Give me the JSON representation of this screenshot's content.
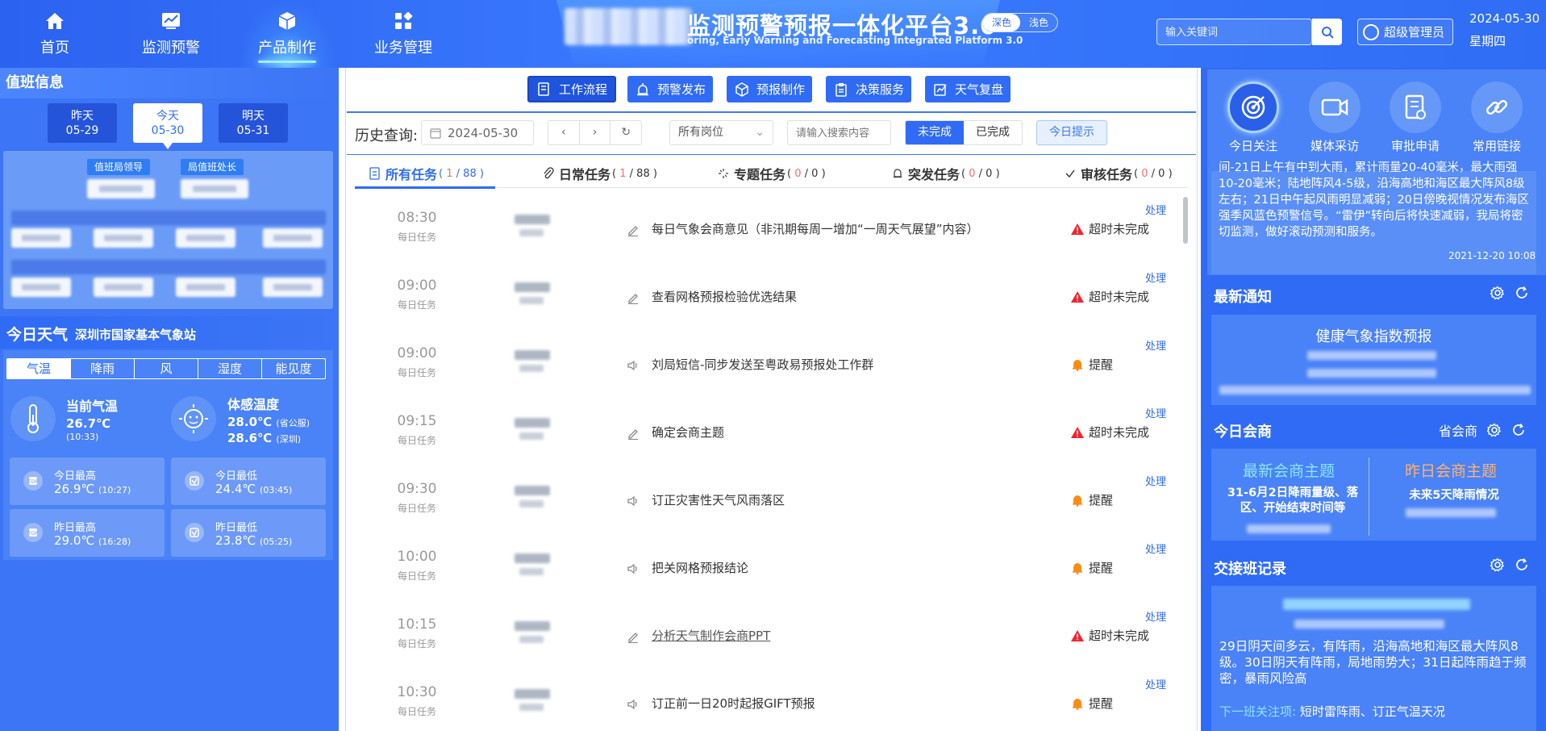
{
  "colors": {
    "primary": "#2f6bf5",
    "danger": "#f5222d",
    "warning": "#fa8c16",
    "accent_cyan": "#8ce6ff",
    "accent_orange": "#ffb36b"
  },
  "nav": [
    {
      "label": "首页",
      "icon": "home-icon"
    },
    {
      "label": "监测预警",
      "icon": "chart-icon"
    },
    {
      "label": "产品制作",
      "icon": "cube-icon",
      "active": true
    },
    {
      "label": "业务管理",
      "icon": "grid-icon"
    }
  ],
  "header": {
    "title": "监测预警预报一体化平台3.0",
    "subtitle": "oring, Early Warning and Forecasting Integrated Platform 3.0",
    "theme_dark": "深色",
    "theme_light": "浅色",
    "search_placeholder": "输入关键词",
    "user": "超级管理员",
    "date": "2024-05-30",
    "weekday": "星期四"
  },
  "duty": {
    "title": "值班信息",
    "days": [
      {
        "name": "昨天",
        "date": "05-29"
      },
      {
        "name": "今天",
        "date": "05-30",
        "selected": true
      },
      {
        "name": "明天",
        "date": "05-31"
      }
    ],
    "tags": [
      "值班局领导",
      "局值班处长"
    ]
  },
  "weather": {
    "title": "今日天气",
    "station": "深圳市国家基本气象站",
    "tabs": [
      "气温",
      "降雨",
      "风",
      "湿度",
      "能见度"
    ],
    "active_tab": "气温",
    "current_label": "当前气温",
    "current_value": "26.7℃",
    "current_time": "(10:33)",
    "feel_label": "体感温度",
    "feel_value1": "28.0℃",
    "feel_note1": "(省公服)",
    "feel_value2": "28.6℃",
    "feel_note2": "(深圳)",
    "cards": [
      {
        "label": "今日最高",
        "value": "26.9℃",
        "time": "(10:27)",
        "icon": "high-temp-icon"
      },
      {
        "label": "今日最低",
        "value": "24.4℃",
        "time": "(03:45)",
        "icon": "low-temp-icon"
      },
      {
        "label": "昨日最高",
        "value": "29.0℃",
        "time": "(16:28)",
        "icon": "high-temp-icon"
      },
      {
        "label": "昨日最低",
        "value": "23.8℃",
        "time": "(05:25)",
        "icon": "low-temp-icon"
      }
    ]
  },
  "workflow": [
    {
      "label": "工作流程",
      "active": true
    },
    {
      "label": "预警发布"
    },
    {
      "label": "预报制作"
    },
    {
      "label": "决策服务"
    },
    {
      "label": "天气复盘"
    }
  ],
  "filters": {
    "history_label": "历史查询:",
    "date": "2024-05-30",
    "post_select": "所有岗位",
    "keyword_placeholder": "请输入搜索内容",
    "undone": "未完成",
    "done": "已完成",
    "tip": "今日提示"
  },
  "task_tabs": [
    {
      "label": "所有任务",
      "done": "1",
      "total": "88",
      "active": true
    },
    {
      "label": "日常任务",
      "done": "1",
      "total": "88"
    },
    {
      "label": "专题任务",
      "done": "0",
      "total": "0"
    },
    {
      "label": "突发任务",
      "done": "0",
      "total": "0"
    },
    {
      "label": "审核任务",
      "done": "0",
      "total": "0"
    }
  ],
  "tasks": [
    {
      "time": "08:30",
      "type": "每日任务",
      "name": "每日气象会商意见（非汛期每周一增加“一周天气展望”内容）",
      "icon": "edit-icon",
      "status": "超时未完成",
      "kind": "overdue",
      "action": "处理"
    },
    {
      "time": "09:00",
      "type": "每日任务",
      "name": "查看网格预报检验优选结果",
      "icon": "edit-icon",
      "status": "超时未完成",
      "kind": "overdue",
      "action": "处理"
    },
    {
      "time": "09:00",
      "type": "每日任务",
      "name": "刘局短信-同步发送至粤政易预报处工作群",
      "icon": "speaker-icon",
      "status": "提醒",
      "kind": "remind",
      "action": "处理"
    },
    {
      "time": "09:15",
      "type": "每日任务",
      "name": "确定会商主题",
      "icon": "edit-icon",
      "status": "超时未完成",
      "kind": "overdue",
      "action": "处理"
    },
    {
      "time": "09:30",
      "type": "每日任务",
      "name": "订正灾害性天气风雨落区",
      "icon": "speaker-icon",
      "status": "提醒",
      "kind": "remind",
      "action": "处理"
    },
    {
      "time": "10:00",
      "type": "每日任务",
      "name": "把关网格预报结论",
      "icon": "speaker-icon",
      "status": "提醒",
      "kind": "remind",
      "action": "处理"
    },
    {
      "time": "10:15",
      "type": "每日任务",
      "name": "分析天气制作会商PPT",
      "icon": "edit-icon",
      "status": "超时未完成",
      "kind": "overdue",
      "action": "处理",
      "link": true
    },
    {
      "time": "10:30",
      "type": "每日任务",
      "name": "订正前一日20时起报GIFT预报",
      "icon": "speaker-icon",
      "status": "提醒",
      "kind": "remind",
      "action": "处理"
    }
  ],
  "quick": [
    {
      "label": "今日关注",
      "icon": "target-icon",
      "active": true
    },
    {
      "label": "媒体采访",
      "icon": "camera-icon"
    },
    {
      "label": "审批申请",
      "icon": "document-icon"
    },
    {
      "label": "常用链接",
      "icon": "link-icon"
    }
  ],
  "focus": {
    "text": "间-21日上午有中到大雨，累计雨量20-40毫米，最大雨强10-20毫米；陆地阵风4-5级，沿海高地和海区最大阵风8级左右；21日中午起风雨明显减弱；20日傍晚视情况发布海区强季风蓝色预警信号。“雷伊”转向后将快速减弱，我局将密切监测，做好滚动预测和服务。",
    "date": "2021-12-20 10:08"
  },
  "notice": {
    "title": "最新通知",
    "item_title": "健康气象指数预报"
  },
  "meeting": {
    "title": "今日会商",
    "scope": "省会商",
    "latest_title": "最新会商主题",
    "latest_text": "31-6月2日降雨量级、落区、开始结束时间等",
    "yesterday_title": "昨日会商主题",
    "yesterday_text": "未来5天降雨情况"
  },
  "handover": {
    "title": "交接班记录",
    "text": "29日阴天间多云，有阵雨，沿海高地和海区最大阵风8级。30日阴天有阵雨，局地雨势大；31日起阵雨趋于频密，暴雨风险高",
    "next_label": "下一班关注项:",
    "next_value": "短时雷阵雨、订正气温天况"
  }
}
